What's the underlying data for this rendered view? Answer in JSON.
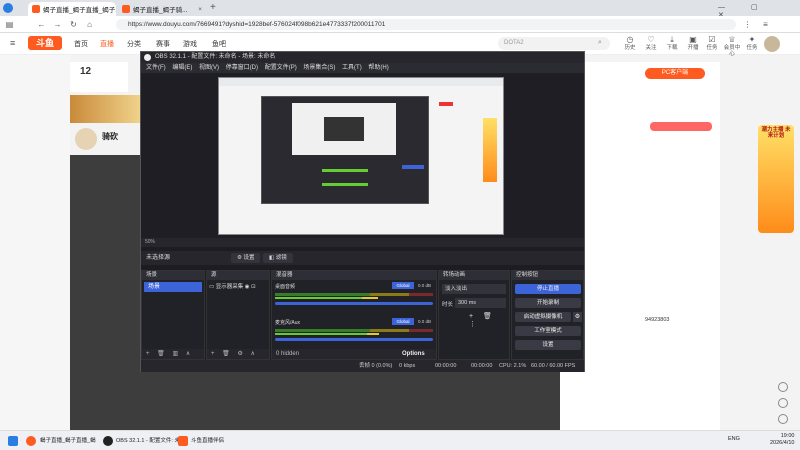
{
  "browser": {
    "tabs": [
      {
        "label": "蝎子直播_蝎子直播_蝎子..."
      },
      {
        "label": "蝎子直播_蝎子骑..."
      }
    ],
    "url": "https://www.douyu.com/7669491?dyshid=1928bef-576024f098b621e4773337f200011701"
  },
  "site": {
    "logo": "斗鱼",
    "nav": [
      "首页",
      "直播",
      "分类",
      "赛事",
      "游戏",
      "鱼吧"
    ],
    "search_placeholder": "DOTA2",
    "header_icons": [
      "历史",
      "关注",
      "下载",
      "开播",
      "任务",
      "会员中心",
      "任务"
    ],
    "room_number": "12",
    "streamer_name": "骑砍",
    "right_panel_button": "PC客户端",
    "qq_text": "94923803",
    "promo_text": "潮力主播 未来计划"
  },
  "obs": {
    "title": "OBS 32.1.1 - 配置文件: 未命名 - 场景: 未命名",
    "menu": [
      "文件(F)",
      "编辑(E)",
      "视图(V)",
      "停靠窗口(D)",
      "配置文件(P)",
      "场景集合(S)",
      "工具(T)",
      "帮助(H)"
    ],
    "zoom": "50%",
    "no_source_selected": "未选择源",
    "properties_label": "设置",
    "filters_label": "滤镜",
    "docks": {
      "scenes": "场景",
      "sources": "源",
      "mixer": "混音器",
      "transitions": "转场动画",
      "controls": "控制按钮"
    },
    "scene_item": "场景",
    "source_item": "显示器采集",
    "mixer": {
      "ch1": "桌面音频",
      "ch1_db": "0.0 dB",
      "ch2": "麦克风/Aux",
      "ch2_db": "0.0 dB",
      "global": "Global",
      "hidden": "0 hidden",
      "options": "Options"
    },
    "transitions": {
      "type": "淡入淡出",
      "duration_label": "时长",
      "duration": "300 ms"
    },
    "controls": [
      "停止直播",
      "开始录制",
      "启动虚拟摄像机",
      "工作室模式",
      "设置"
    ],
    "status": {
      "dropped": "丢帧 0 (0.0%)",
      "kbps": "0 kbps",
      "live_time": "00:00:00",
      "rec_time": "00:00:00",
      "cpu": "CPU: 2.1%",
      "fps": "60.00 / 60.00 FPS"
    }
  },
  "taskbar": {
    "items": [
      "蝎子直播_蝎子直播_蝎",
      "OBS 32.1.1 - 配置文件: 未",
      "斗鱼直播伴侣"
    ],
    "lang": "ENG",
    "time": "19:00",
    "date": "2026/4/10"
  },
  "colors": {
    "brand": "#ff5a1f",
    "obs_accent": "#3c64d8"
  }
}
